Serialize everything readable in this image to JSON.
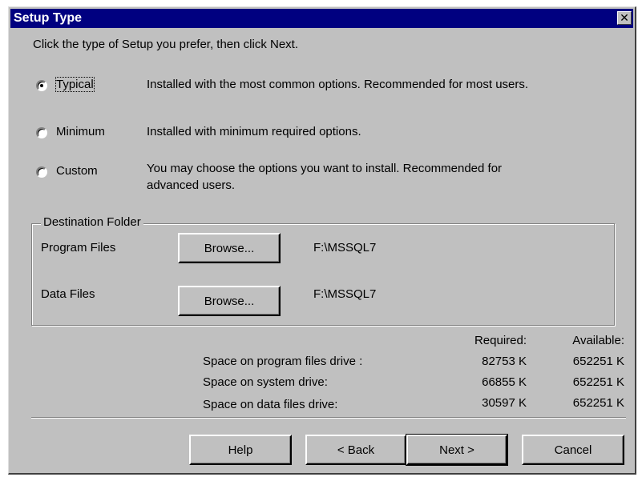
{
  "window": {
    "title": "Setup Type",
    "close_glyph": "✕"
  },
  "instruction": "Click the type of Setup you prefer, then click Next.",
  "setup_options": [
    {
      "label": "Typical",
      "description": "Installed with the most common options. Recommended for most users.",
      "selected": true
    },
    {
      "label": "Minimum",
      "description": "Installed with minimum required options.",
      "selected": false
    },
    {
      "label": "Custom",
      "description_line1": "You may choose the options you want to install. Recommended for",
      "description_line2": "advanced users.",
      "selected": false
    }
  ],
  "destination": {
    "legend": "Destination Folder",
    "program_files": {
      "label": "Program Files",
      "button": "Browse...",
      "path": "F:\\MSSQL7"
    },
    "data_files": {
      "label": "Data Files",
      "button": "Browse...",
      "path": "F:\\MSSQL7"
    }
  },
  "space": {
    "header_required": "Required:",
    "header_available": "Available:",
    "rows": [
      {
        "label": "Space on program files drive :",
        "required": "82753 K",
        "available": "652251 K"
      },
      {
        "label": "Space on system drive:",
        "required": "66855 K",
        "available": "652251 K"
      },
      {
        "label": "Space on data files drive:",
        "required": "30597 K",
        "available": "652251 K"
      }
    ]
  },
  "buttons": {
    "help": "Help",
    "back": "< Back",
    "next": "Next >",
    "cancel": "Cancel"
  },
  "colors": {
    "titlebar": "#000080",
    "face": "#c0c0c0"
  }
}
